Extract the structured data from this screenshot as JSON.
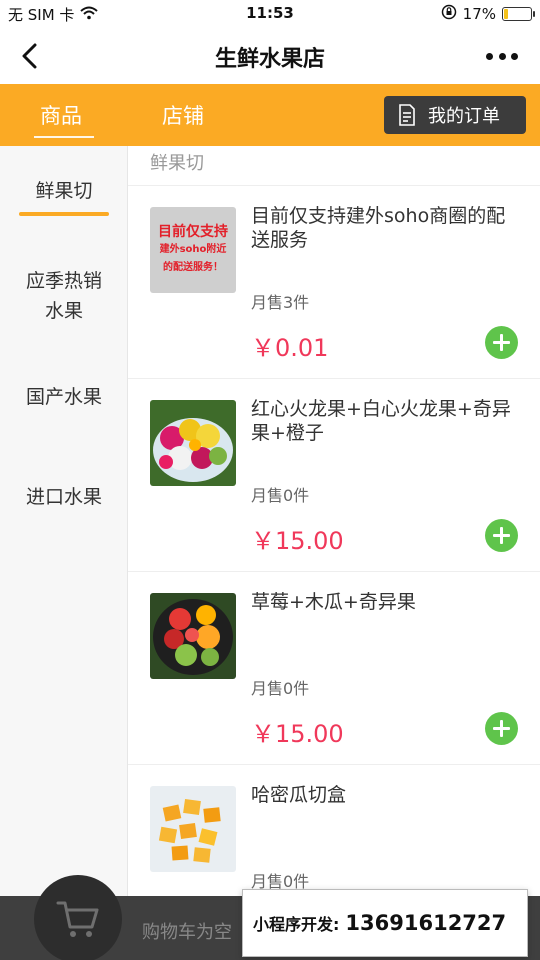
{
  "status_bar": {
    "carrier": "无 SIM 卡",
    "time": "11:53",
    "battery": "17%",
    "battery_level": 0.17,
    "battery_color": "#f5c21b"
  },
  "nav": {
    "title": "生鲜水果店",
    "back_icon": "chevron-left-icon",
    "more_icon": "more-dots-icon"
  },
  "tabs": {
    "goods": "商品",
    "shop": "店铺",
    "orders": "我的订单",
    "accent_color": "#fbaa24"
  },
  "categories": [
    {
      "label": "鲜果切",
      "active": true
    },
    {
      "label_line1": "应季热销",
      "label_line2": "水果"
    },
    {
      "label": "国产水果"
    },
    {
      "label": "进口水果"
    }
  ],
  "section": {
    "title": "鲜果切"
  },
  "products": [
    {
      "name": "目前仅支持建外soho商圈的配送服务",
      "sold": "月售3件",
      "price": "￥0.01",
      "thumb_text": [
        "目前仅支持",
        "建外soho附近",
        "的配送服务！"
      ]
    },
    {
      "name": "红心火龙果+白心火龙果+奇异果+橙子",
      "sold": "月售0件",
      "price": "￥15.00"
    },
    {
      "name": "草莓+木瓜+奇异果",
      "sold": "月售0件",
      "price": "￥15.00"
    },
    {
      "name": "哈密瓜切盒",
      "sold": "月售0件"
    }
  ],
  "cart": {
    "empty_text": "购物车为空",
    "icon": "cart-icon"
  },
  "promo": {
    "label": "小程序开发:",
    "phone": "13691612727"
  },
  "colors": {
    "price": "#f0385a",
    "add_button": "#5fc44b",
    "cart_bar": "#3f3f3f"
  }
}
